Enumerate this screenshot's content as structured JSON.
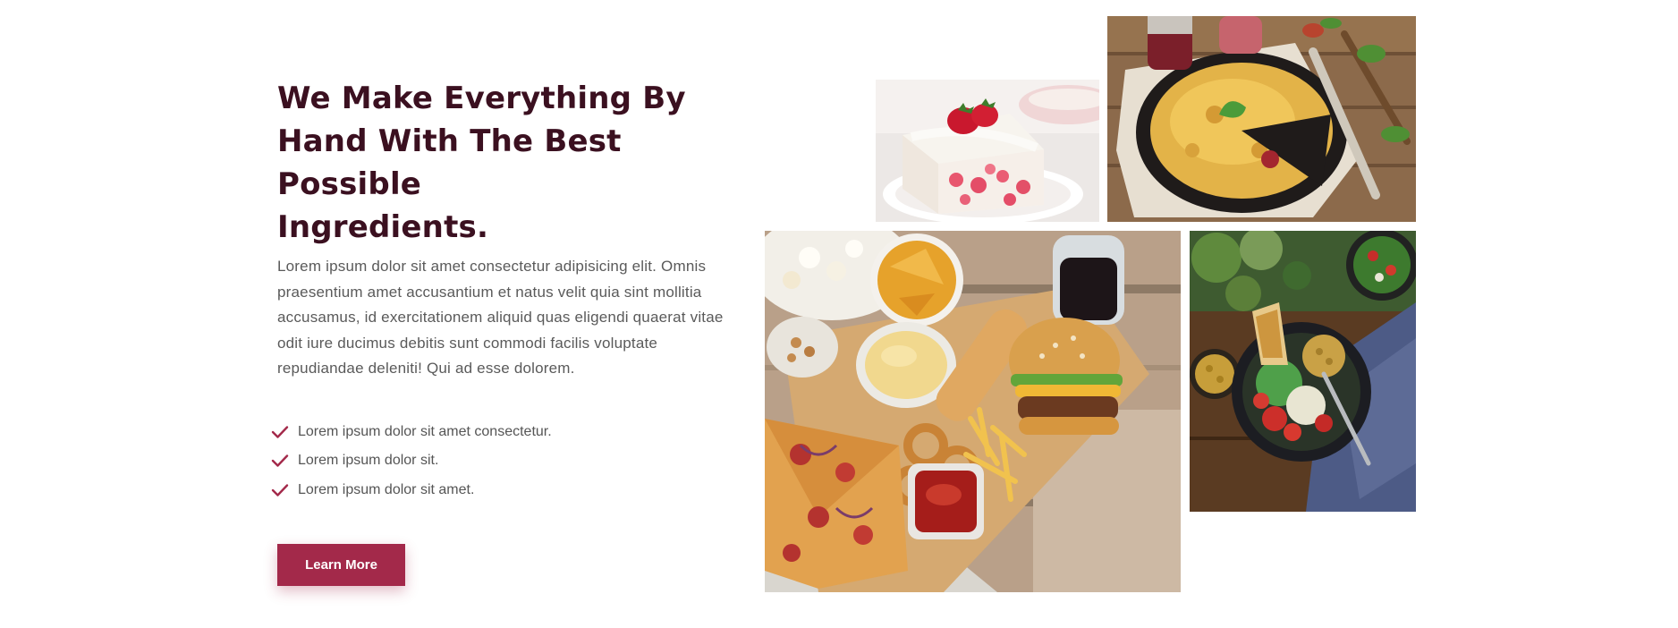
{
  "about": {
    "headline_line1": "We Make Everything By",
    "headline_line2": "Hand With The Best Possible",
    "headline_line3": "Ingredients.",
    "paragraph": "Lorem ipsum dolor sit amet consectetur adipisicing elit. Omnis praesentium amet accusantium et natus velit quia sint mollitia accusamus, id exercitationem aliquid quas eligendi quaerat vitae odit iure ducimus debitis sunt commodi facilis voluptate repudiandae deleniti! Qui ad esse dolorem.",
    "checklist": [
      "Lorem ipsum dolor sit amet consectetur.",
      "Lorem ipsum dolor sit.",
      "Lorem ipsum dolor sit amet."
    ],
    "button_label": "Learn More"
  },
  "gallery": {
    "images": [
      "strawberry-cake-image",
      "cheese-pie-image",
      "fast-food-snacks-image",
      "salad-bowl-image"
    ]
  },
  "colors": {
    "accent": "#a3294a",
    "headline": "#3b1020",
    "body_text": "#5a5a5a"
  }
}
